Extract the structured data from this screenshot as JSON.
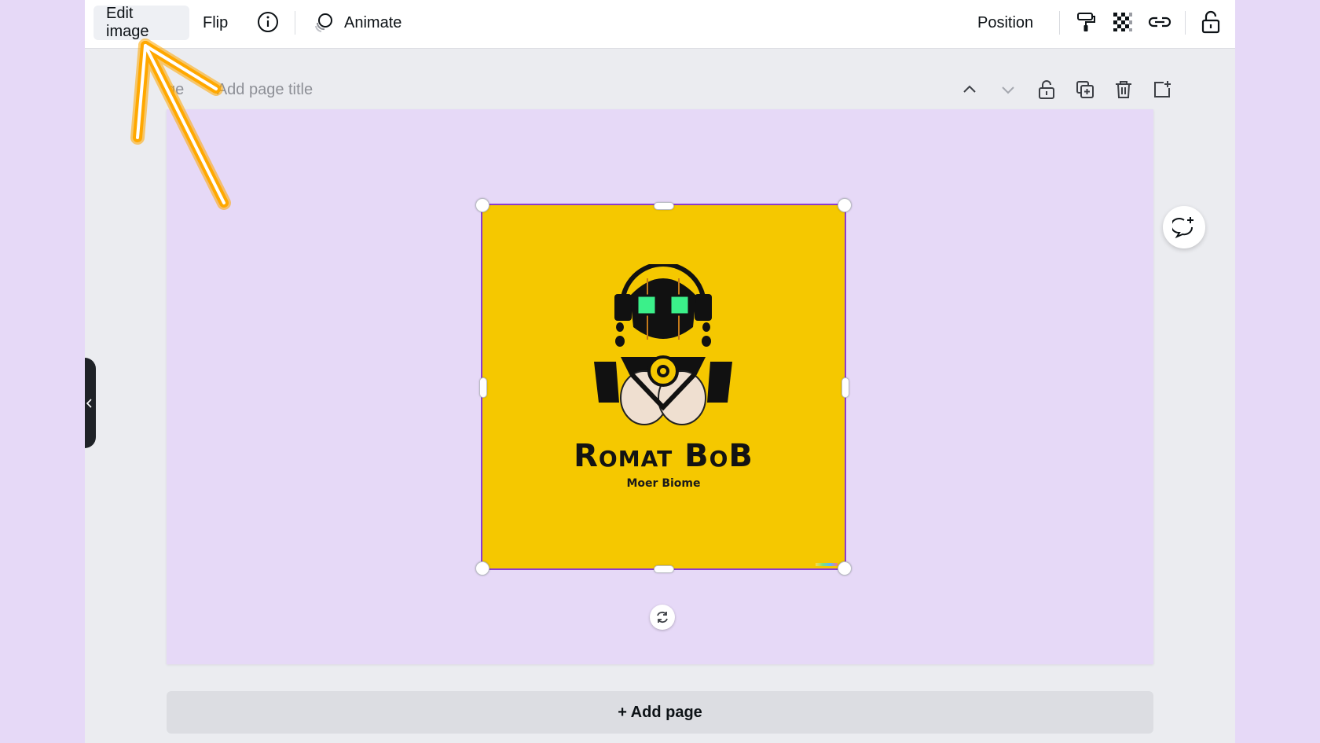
{
  "toolbar": {
    "edit_image_label": "Edit image",
    "flip_label": "Flip",
    "animate_label": "Animate",
    "position_label": "Position"
  },
  "page_header": {
    "title_placeholder": "Add page title",
    "page_label_fragment": "ge"
  },
  "design": {
    "title": "Romat BoB",
    "subtitle": "Moer Biome",
    "background_color": "#f5c800",
    "eye_color": "#3bf08a"
  },
  "add_page_label": "+ Add page",
  "colors": {
    "canvas": "#e6d9f7",
    "selection": "#8b3dd0",
    "annotation_arrow": "#ffa800"
  },
  "icons": [
    "info-icon",
    "animate-icon",
    "paint-roller-icon",
    "transparency-icon",
    "link-icon",
    "lock-icon",
    "chevron-up-icon",
    "chevron-down-icon",
    "page-lock-icon",
    "duplicate-page-icon",
    "delete-icon",
    "add-page-icon",
    "rotate-icon",
    "add-comment-icon",
    "collapse-chevron-icon"
  ]
}
